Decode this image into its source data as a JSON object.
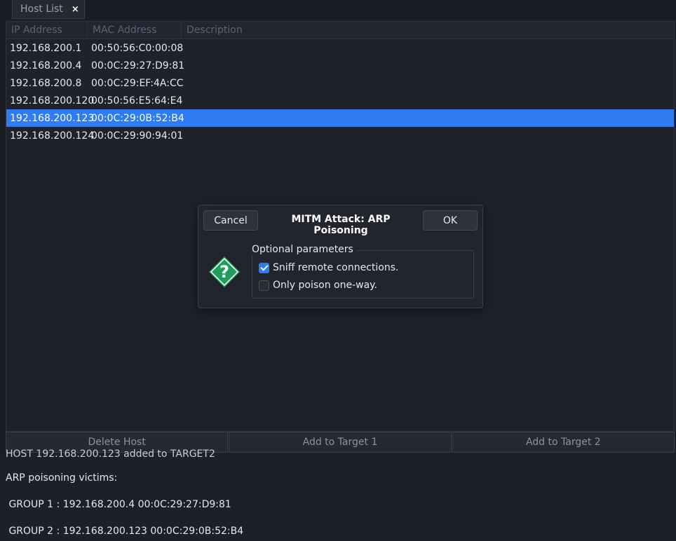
{
  "tabs": [
    {
      "label": "Host List",
      "close": "×"
    }
  ],
  "host_list": {
    "columns": [
      "IP Address",
      "MAC Address",
      "Description"
    ],
    "rows": [
      {
        "ip": "192.168.200.1",
        "mac": "00:50:56:C0:00:08",
        "description": ""
      },
      {
        "ip": "192.168.200.4",
        "mac": "00:0C:29:27:D9:81",
        "description": ""
      },
      {
        "ip": "192.168.200.8",
        "mac": "00:0C:29:EF:4A:CC",
        "description": ""
      },
      {
        "ip": "192.168.200.120",
        "mac": "00:50:56:E5:64:E4",
        "description": ""
      },
      {
        "ip": "192.168.200.123",
        "mac": "00:0C:29:0B:52:B4",
        "description": "",
        "selected": true
      },
      {
        "ip": "192.168.200.124",
        "mac": "00:0C:29:90:94:01",
        "description": ""
      }
    ]
  },
  "buttons": {
    "delete_host": "Delete Host",
    "add_target1": "Add to Target 1",
    "add_target2": "Add to Target 2"
  },
  "log": {
    "cut_line": "HOST 192.168.200.123 added to TARGET2",
    "lines": [
      "ARP poisoning victims:",
      " GROUP 1 : 192.168.200.4 00:0C:29:27:D9:81",
      " GROUP 2 : 192.168.200.123 00:0C:29:0B:52:B4"
    ]
  },
  "dialog": {
    "title": "MITM Attack: ARP Poisoning",
    "cancel": "Cancel",
    "ok": "OK",
    "icon": "question-icon",
    "frame_label": "Optional parameters",
    "options": [
      {
        "label": "Sniff remote connections.",
        "checked": true
      },
      {
        "label": "Only poison one-way.",
        "checked": false
      }
    ]
  },
  "colors": {
    "selection": "#2f7bf1",
    "icon_green": "#1e9e5a"
  }
}
